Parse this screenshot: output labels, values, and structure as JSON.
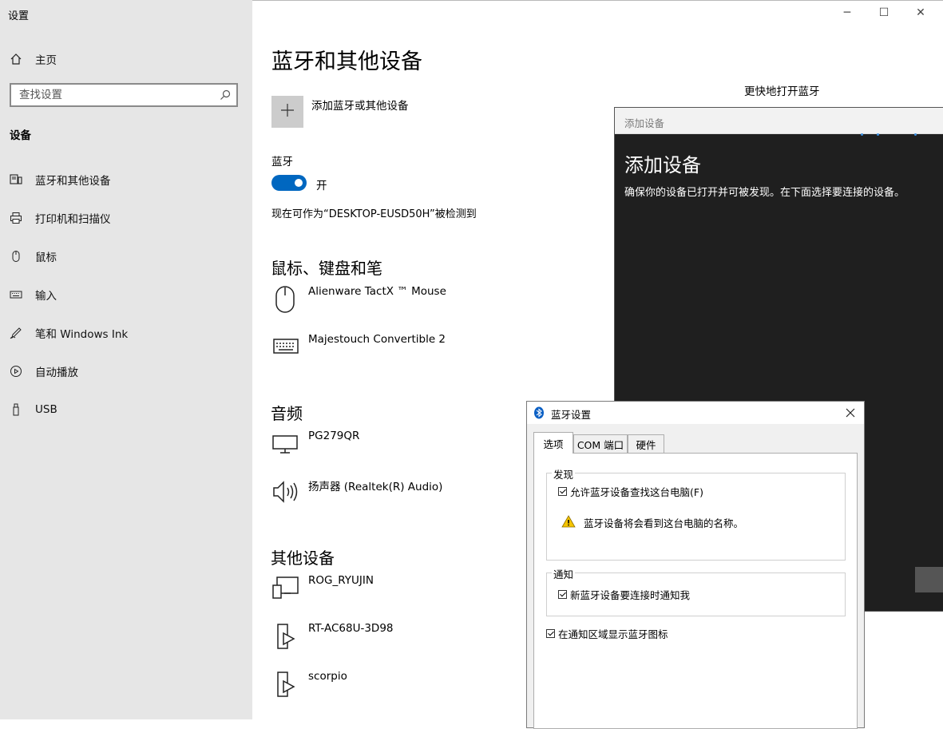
{
  "window": {
    "app_title": "设置",
    "controls": {
      "minimize": "─",
      "maximize": "☐",
      "close": "✕"
    }
  },
  "sidebar": {
    "home_label": "主页",
    "search_placeholder": "查找设置",
    "section_title": "设备",
    "items": [
      {
        "label": "蓝牙和其他设备",
        "icon": "bluetooth-devices-icon"
      },
      {
        "label": "打印机和扫描仪",
        "icon": "printer-icon"
      },
      {
        "label": "鼠标",
        "icon": "mouse-icon"
      },
      {
        "label": "输入",
        "icon": "keyboard-icon"
      },
      {
        "label": "笔和 Windows Ink",
        "icon": "pen-icon"
      },
      {
        "label": "自动播放",
        "icon": "autoplay-icon"
      },
      {
        "label": "USB",
        "icon": "usb-icon"
      }
    ]
  },
  "main": {
    "title": "蓝牙和其他设备",
    "add_device_label": "添加蓝牙或其他设备",
    "bluetooth_label": "蓝牙",
    "bluetooth_state": "开",
    "discoverable_text": "现在可作为“DESKTOP-EUSD50H”被检测到",
    "quick_open_title": "更快地打开蓝牙",
    "sections": {
      "input": {
        "title": "鼠标、键盘和笔",
        "devices": [
          "Alienware TactX ™ Mouse",
          "Majestouch Convertible 2"
        ]
      },
      "audio": {
        "title": "音频",
        "devices": [
          "PG279QR",
          "扬声器 (Realtek(R) Audio)"
        ]
      },
      "other": {
        "title": "其他设备",
        "devices": [
          "ROG_RYUJIN",
          "RT-AC68U-3D98",
          "scorpio"
        ]
      }
    }
  },
  "add_device_dialog": {
    "titlebar": "添加设备",
    "heading": "添加设备",
    "description": "确保你的设备已打开并可被发现。在下面选择要连接的设备。"
  },
  "bt_settings_dialog": {
    "title": "蓝牙设置",
    "tabs": [
      "选项",
      "COM 端口",
      "硬件"
    ],
    "discovery_group": "发现",
    "allow_discovery": "允许蓝牙设备查找这台电脑(F)",
    "allow_discovery_checked": true,
    "warning_text": "蓝牙设备将会看到这台电脑的名称。",
    "notify_group": "通知",
    "notify_new": "新蓝牙设备要连接时通知我",
    "notify_new_checked": true,
    "show_tray_icon": "在通知区域显示蓝牙图标",
    "show_tray_icon_checked": true
  },
  "colors": {
    "sidebar_bg": "#e6e6e6",
    "accent": "#0067c0",
    "dialog_dark": "#1f1f1f"
  }
}
